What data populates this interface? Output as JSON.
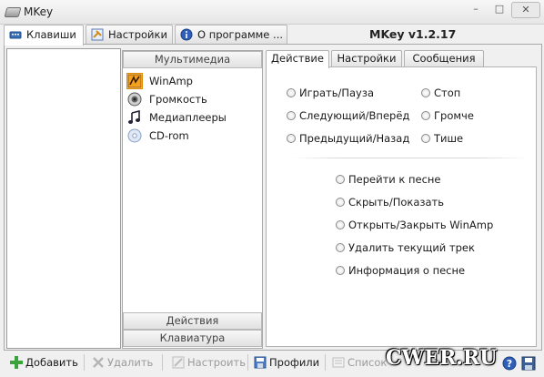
{
  "window": {
    "title": "MKey",
    "minimize": "–",
    "maximize": "□",
    "close": "✕"
  },
  "tabs": [
    {
      "label": "Клавиши",
      "icon": "keyboard-icon",
      "active": true
    },
    {
      "label": "Настройки",
      "icon": "settings-icon",
      "active": false
    },
    {
      "label": "О программе ...",
      "icon": "info-icon",
      "active": false
    }
  ],
  "version": "MKey v1.2.17",
  "categories": {
    "multimedia_header": "Мультимедиа",
    "items": [
      {
        "label": "WinAmp",
        "icon": "winamp-icon",
        "selected": true
      },
      {
        "label": "Громкость",
        "icon": "speaker-icon",
        "selected": false
      },
      {
        "label": "Медиаплееры",
        "icon": "music-note-icon",
        "selected": false
      },
      {
        "label": "CD-rom",
        "icon": "cd-icon",
        "selected": false
      }
    ],
    "actions_header": "Действия",
    "keyboard_header": "Клавиатура"
  },
  "subtabs": [
    {
      "label": "Действие",
      "active": true
    },
    {
      "label": "Настройки",
      "active": false
    },
    {
      "label": "Сообщения",
      "active": false
    }
  ],
  "actions": {
    "col1": [
      "Играть/Пауза",
      "Следующий/Вперёд",
      "Предыдущий/Назад"
    ],
    "col2": [
      "Стоп",
      "Громче",
      "Тише"
    ],
    "list": [
      "Перейти к песне",
      "Скрыть/Показать",
      "Открыть/Закрыть WinAmp",
      "Удалить текущий трек",
      "Информация о песне"
    ]
  },
  "toolbar": {
    "add": "Добавить",
    "delete": "Удалить",
    "configure": "Настроить",
    "profiles": "Профили",
    "list": "Список"
  },
  "watermark": "CWER.RU"
}
